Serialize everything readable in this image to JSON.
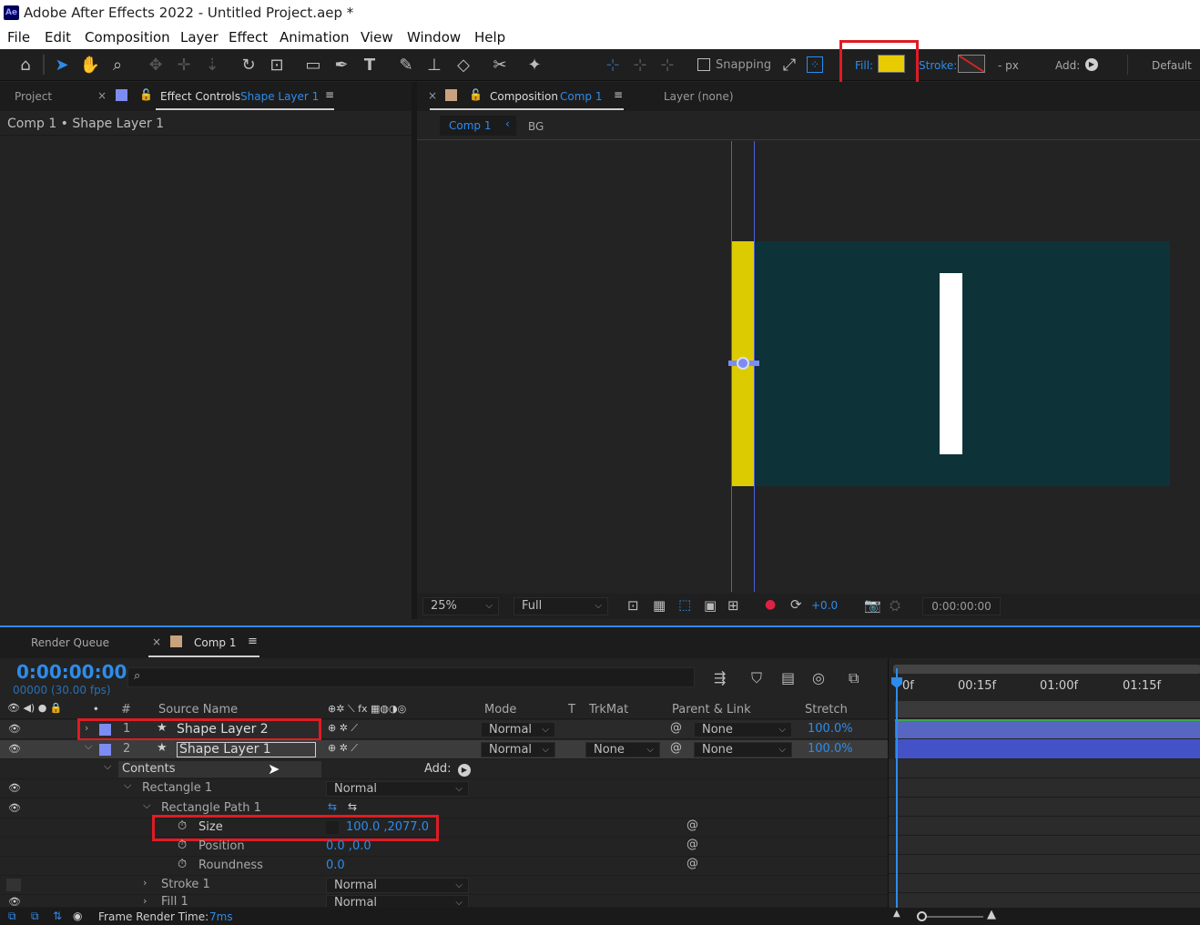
{
  "window": {
    "title": "Adobe After Effects 2022 - Untitled Project.aep *",
    "app_badge": "Ae"
  },
  "menu": [
    "File",
    "Edit",
    "Composition",
    "Layer",
    "Effect",
    "Animation",
    "View",
    "Window",
    "Help"
  ],
  "toolbar": {
    "snapping_label": "Snapping",
    "fill_label": "Fill:",
    "fill_color": "#e6cc00",
    "stroke_label": "Stroke:",
    "stroke_width": "-  px",
    "add_label": "Add:",
    "workspace": "Default"
  },
  "project_panel": {
    "tab_project": "Project",
    "tab_effect_controls": "Effect Controls",
    "tab_effect_controls_layer": "Shape Layer 1",
    "breadcrumb": "Comp 1 • Shape Layer 1"
  },
  "comp_panel": {
    "tab_composition": "Composition",
    "tab_composition_name": "Comp 1",
    "tab_layer": "Layer (none)",
    "sub_tab_active": "Comp 1",
    "sub_tab_other": "BG",
    "zoom": "25%",
    "resolution": "Full",
    "exposure": "+0.0",
    "timecode": "0:00:00:00",
    "bg_color": "#0d3338",
    "shape_yellow": "#dccb00"
  },
  "timeline": {
    "tab_render_queue": "Render Queue",
    "tab_comp": "Comp 1",
    "current_time": "0:00:00:00",
    "frame_info": "00000 (30.00 fps)",
    "columns": {
      "num": "#",
      "source_name": "Source Name",
      "mode": "Mode",
      "t": "T",
      "trkmat": "TrkMat",
      "parent": "Parent & Link",
      "stretch": "Stretch"
    },
    "ruler": [
      "0f",
      "00:15f",
      "01:00f",
      "01:15f"
    ],
    "layers": [
      {
        "num": "1",
        "name": "Shape Layer 2",
        "mode": "Normal",
        "trkmat": "",
        "parent": "None",
        "stretch": "100.0%",
        "color": "#7d8cf2"
      },
      {
        "num": "2",
        "name": "Shape Layer 1",
        "mode": "Normal",
        "trkmat": "None",
        "parent": "None",
        "stretch": "100.0%",
        "color": "#7d8cf2"
      }
    ],
    "contents_label": "Contents",
    "add_label": "Add:",
    "rectangle_label": "Rectangle 1",
    "rectangle_mode": "Normal",
    "rect_path_label": "Rectangle Path 1",
    "size_label": "Size",
    "size_value": "100.0 ,2077.0",
    "position_label": "Position",
    "position_value": "0.0 ,0.0",
    "roundness_label": "Roundness",
    "roundness_value": "0.0",
    "stroke_label": "Stroke 1",
    "stroke_mode": "Normal",
    "fill_label": "Fill 1",
    "fill_mode": "Normal"
  },
  "status": {
    "frame_render_label": "Frame Render Time:",
    "frame_render_value": "7ms"
  }
}
